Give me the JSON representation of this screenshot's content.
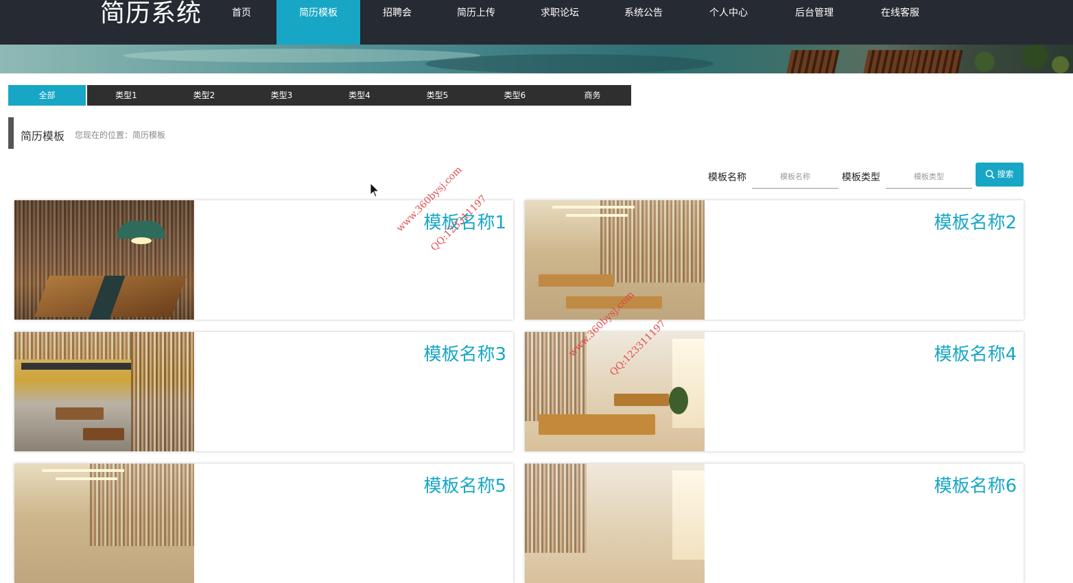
{
  "app": {
    "logo": "简历系统"
  },
  "nav": [
    {
      "label": "首页",
      "active": false
    },
    {
      "label": "简历模板",
      "active": true
    },
    {
      "label": "招聘会",
      "active": false
    },
    {
      "label": "简历上传",
      "active": false
    },
    {
      "label": "求职论坛",
      "active": false
    },
    {
      "label": "系统公告",
      "active": false
    },
    {
      "label": "个人中心",
      "active": false
    },
    {
      "label": "后台管理",
      "active": false
    },
    {
      "label": "在线客服",
      "active": false
    }
  ],
  "categories": [
    {
      "label": "全部",
      "active": true
    },
    {
      "label": "类型1",
      "active": false
    },
    {
      "label": "类型2",
      "active": false
    },
    {
      "label": "类型3",
      "active": false
    },
    {
      "label": "类型4",
      "active": false
    },
    {
      "label": "类型5",
      "active": false
    },
    {
      "label": "类型6",
      "active": false
    },
    {
      "label": "商务",
      "active": false
    }
  ],
  "page": {
    "title": "简历模板",
    "location": "您现在的位置：简历模板"
  },
  "search": {
    "name_label": "模板名称",
    "name_placeholder": "模板名称",
    "name_value": "",
    "type_label": "模板类型",
    "type_placeholder": "模板类型",
    "type_value": "",
    "button_label": "搜索"
  },
  "cards": [
    {
      "name": "模板名称1",
      "image": "library-reading-room-lamp"
    },
    {
      "name": "模板名称2",
      "image": "library-aisle-tables"
    },
    {
      "name": "模板名称3",
      "image": "bookstore-multilevel"
    },
    {
      "name": "模板名称4",
      "image": "library-sunlit-tables"
    },
    {
      "name": "模板名称5",
      "image": "library-aisle-tables"
    },
    {
      "name": "模板名称6",
      "image": "library-sunlit-tables"
    }
  ],
  "watermark": {
    "site": "www.360bysj.com",
    "qq": "QQ:123311197"
  },
  "colors": {
    "accent": "#17a6c5",
    "header": "#262a32",
    "tab_bg": "#2f2f2f"
  }
}
